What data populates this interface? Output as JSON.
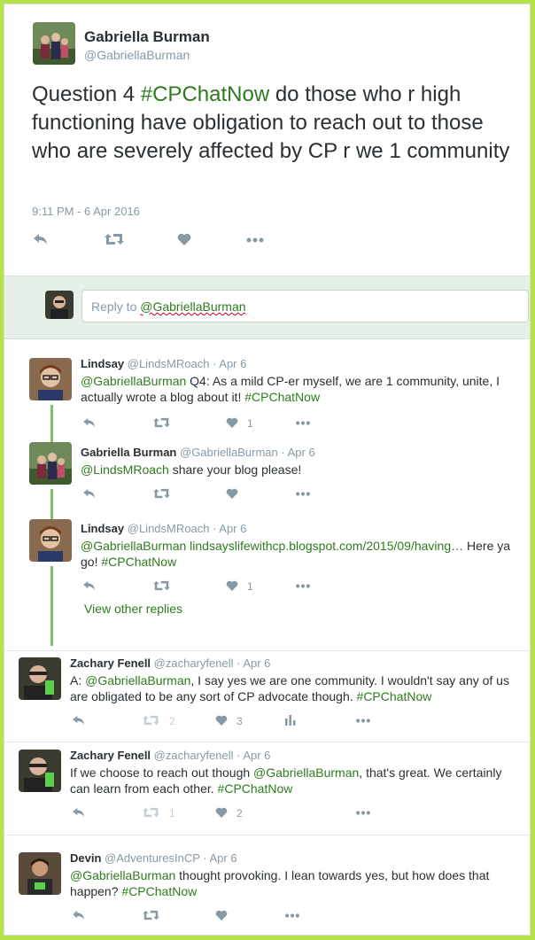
{
  "main_tweet": {
    "name": "Gabriella Burman",
    "handle": "@GabriellaBurman",
    "text_pre": "Question 4 ",
    "hashtag": "#CPChatNow",
    "text_post": " do those who r high functioning have obligation to reach out to those who are severely affected by CP r we 1 community",
    "timestamp": "9:11 PM - 6 Apr 2016"
  },
  "reply_box": {
    "prefix": "Reply to ",
    "mention": "@GabriellaBurman"
  },
  "replies": [
    {
      "name": "Lindsay",
      "handle": "@LindsMRoach",
      "date": "· Apr 6",
      "mention": "@GabriellaBurman",
      "text": " Q4: As a mild CP-er myself, we are 1 community, unite, I actually wrote a blog about it! ",
      "hashtag": "#CPChatNow",
      "like_count": "1"
    },
    {
      "name": "Gabriella Burman",
      "handle": "@GabriellaBurman",
      "date": "· Apr 6",
      "mention": "@LindsMRoach",
      "text": " share your blog please!"
    },
    {
      "name": "Lindsay",
      "handle": "@LindsMRoach",
      "date": "· Apr 6",
      "mention": "@GabriellaBurman",
      "link": " lindsayslifewithcp.blogspot.com/2015/09/having…",
      "text": " Here ya go! ",
      "hashtag": "#CPChatNow",
      "like_count": "1"
    },
    {
      "name": "Zachary Fenell",
      "handle": "@zacharyfenell",
      "date": "· Apr 6",
      "pre": "A: ",
      "mention": "@GabriellaBurman",
      "text": ", I say yes we are one community. I wouldn't say any of us are obligated to be any sort of CP advocate though. ",
      "hashtag": "#CPChatNow",
      "retweet_count": "2",
      "like_count": "3"
    },
    {
      "name": "Zachary Fenell",
      "handle": "@zacharyfenell",
      "date": "· Apr 6",
      "pre": "If we choose to reach out though ",
      "mention": "@GabriellaBurman",
      "text": ", that's great. We certainly can learn from each other. ",
      "hashtag": "#CPChatNow",
      "retweet_count": "1",
      "like_count": "2"
    },
    {
      "name": "Devin",
      "handle": "@AdventuresInCP",
      "date": "· Apr 6",
      "mention": "@GabriellaBurman",
      "text": " thought provoking. I lean towards yes, but how does that happen? ",
      "hashtag": "#CPChatNow"
    }
  ],
  "view_other_replies": "View other replies",
  "colors": {
    "accent": "#2f7a1f",
    "frame": "#b6e34a",
    "thread": "#7cc16a",
    "reply_bg": "#e6f0e6"
  }
}
